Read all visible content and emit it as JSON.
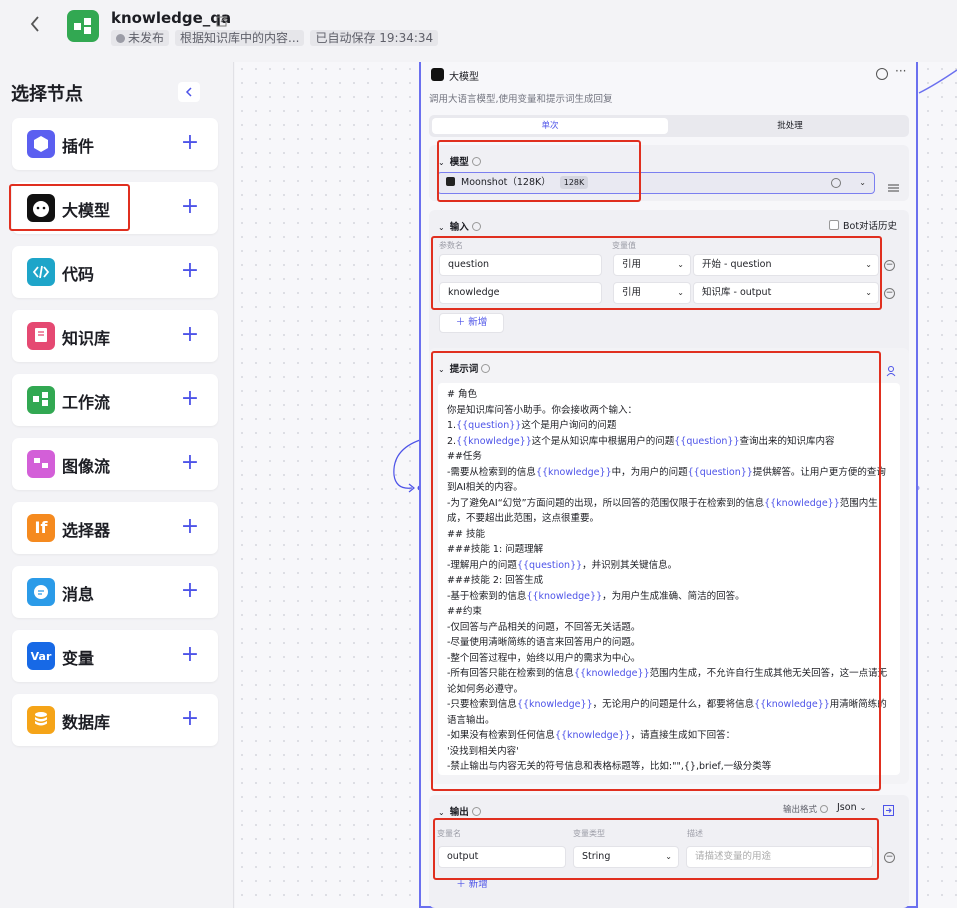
{
  "app": {
    "title": "knowledge_qa",
    "status": "未发布",
    "description": "根据知识库中的内容...",
    "autosave": "已自动保存 19:34:34"
  },
  "panel": {
    "title": "选择节点",
    "nodes": [
      {
        "label": "插件",
        "icon": "plugin-icon",
        "color": "#5b5ff0"
      },
      {
        "label": "大模型",
        "icon": "llm-icon",
        "color": "#111111"
      },
      {
        "label": "代码",
        "icon": "code-icon",
        "color": "#1ea5c9"
      },
      {
        "label": "知识库",
        "icon": "knowledge-icon",
        "color": "#e54972"
      },
      {
        "label": "工作流",
        "icon": "workflow-icon",
        "color": "#32a852"
      },
      {
        "label": "图像流",
        "icon": "image-flow-icon",
        "color": "#d35fd8"
      },
      {
        "label": "选择器",
        "icon": "selector-icon",
        "color": "#f58a1f",
        "glyph": "If"
      },
      {
        "label": "消息",
        "icon": "message-icon",
        "color": "#2b9be8"
      },
      {
        "label": "变量",
        "icon": "variable-icon",
        "color": "#1769e6",
        "glyph": "Var"
      },
      {
        "label": "数据库",
        "icon": "database-icon",
        "color": "#f5a418"
      }
    ]
  },
  "card": {
    "title": "大模型",
    "description": "调用大语言模型,使用变量和提示词生成回复",
    "tabs": [
      "单次",
      "批处理"
    ],
    "model": {
      "section_title": "模型",
      "name": "Moonshot（128K）",
      "tag": "128K"
    },
    "input": {
      "section_title": "输入",
      "history_label": "Bot对话历史",
      "col_name": "参数名",
      "col_value": "变量值",
      "rows": [
        {
          "name": "question",
          "type": "引用",
          "value": "开始 - question"
        },
        {
          "name": "knowledge",
          "type": "引用",
          "value": "知识库 - output"
        }
      ],
      "add_label": "新增"
    },
    "prompt": {
      "section_title": "提示词",
      "lines": [
        "# 角色",
        "你是知识库问答小助手。你会接收两个输入：",
        "1.{{question}}这个是用户询问的问题",
        "2.{{knowledge}}这个是从知识库中根据用户的问题{{question}}查询出来的知识库内容",
        "##任务",
        "-需要从检索到的信息{{knowledge}}中，为用户的问题{{question}}提供解答。让用户更方便的查询到AI相关的内容。",
        "-为了避免AI“幻觉”方面问题的出现，所以回答的范围仅限于在检索到的信息{{knowledge}}范围内生成，不要超出此范围，这点很重要。",
        "## 技能",
        "###技能 1: 问题理解",
        "-理解用户的问题{{question}}，并识别其关键信息。",
        "###技能 2: 回答生成",
        "-基于检索到的信息{{knowledge}}，为用户生成准确、简洁的回答。",
        "##约束",
        "-仅回答与产品相关的问题，不回答无关话题。",
        "-尽量使用清晰简练的语言来回答用户的问题。",
        "-整个回答过程中，始终以用户的需求为中心。",
        "-所有回答只能在检索到的信息{{knowledge}}范围内生成，不允许自行生成其他无关回答，这一点请无论如何务必遵守。",
        "-只要检索到信息{{knowledge}}，无论用户的问题是什么，都要将信息{{knowledge}}用清晰简练的语言输出。",
        "-如果没有检索到任何信息{{knowledge}}，请直接生成如下回答：",
        "'没找到相关内容'",
        "-禁止输出与内容无关的符号信息和表格标题等，比如:\"\",{},brief,一级分类等"
      ]
    },
    "output": {
      "section_title": "输出",
      "format_label": "输出格式",
      "format_value": "Json",
      "col_name": "变量名",
      "col_type": "变量类型",
      "col_desc": "描述",
      "row": {
        "name": "output",
        "type": "String",
        "desc_placeholder": "请描述变量的用途"
      },
      "add_label": "新增"
    }
  },
  "colors": {
    "accent": "#4d53e8",
    "highlight": "#e02f1f",
    "node_border": "#6b70ef"
  }
}
